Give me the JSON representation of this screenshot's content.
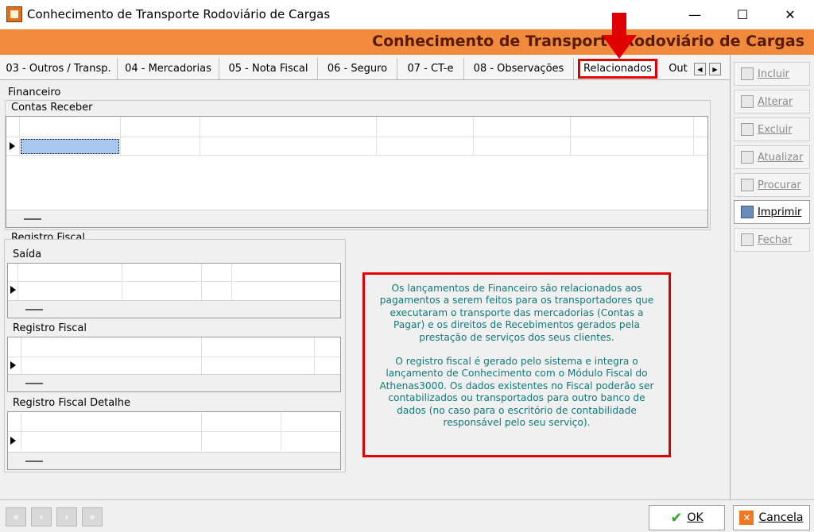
{
  "window": {
    "title": "Conhecimento de Transporte Rodoviário de Cargas",
    "minimize_glyph": "—",
    "maximize_glyph": "☐",
    "close_glyph": "✕"
  },
  "header": {
    "title": "Conhecimento de Transporte Rodoviário de Cargas"
  },
  "tabs": [
    {
      "label": "03 - Outros / Transp."
    },
    {
      "label": "04 - Mercadorias"
    },
    {
      "label": "05 - Nota Fiscal"
    },
    {
      "label": "06 - Seguro"
    },
    {
      "label": "07 - CT-e"
    },
    {
      "label": "08 - Observações"
    },
    {
      "label": "Relacionados"
    },
    {
      "label": "Out"
    }
  ],
  "tab_scroll": {
    "left": "◀",
    "right": "▶"
  },
  "toolbar": {
    "incluir": "Incluir",
    "alterar": "Alterar",
    "excluir": "Excluir",
    "atualizar": "Atualizar",
    "procurar": "Procurar",
    "imprimir": "Imprimir",
    "fechar": "Fechar"
  },
  "sections": {
    "financeiro": "Financeiro",
    "contas_receber": "Contas Receber",
    "registro_fiscal": "Registro Fiscal",
    "saida": "Saída",
    "registro_fiscal_inner": "Registro Fiscal",
    "registro_fiscal_detalhe": "Registro Fiscal Detalhe"
  },
  "info": {
    "paragraph1": "Os lançamentos de Financeiro são relacionados aos pagamentos a serem feitos para os transportadores que executaram o transporte das mercadorias (Contas a Pagar) e os direitos de Recebimentos  gerados pela prestação de serviços dos seus clientes.",
    "paragraph2": "O registro fiscal é gerado pelo sistema e integra o lançamento de Conhecimento com o Módulo Fiscal do Athenas3000. Os dados existentes no Fiscal poderão ser contabilizados ou transportados para outro banco de dados (no caso para o escritório de contabilidade responsável pelo seu serviço)."
  },
  "navigation": {
    "first": "«",
    "prev": "‹",
    "next": "›",
    "last": "»"
  },
  "actions": {
    "ok": "OK",
    "cancel": "Cancela",
    "ok_glyph": "✔",
    "cancel_glyph": "✕"
  },
  "colors": {
    "header_band": "#f08a3c",
    "header_text": "#5a1a00",
    "highlight_red": "#e00000",
    "info_text": "#107a7a"
  }
}
